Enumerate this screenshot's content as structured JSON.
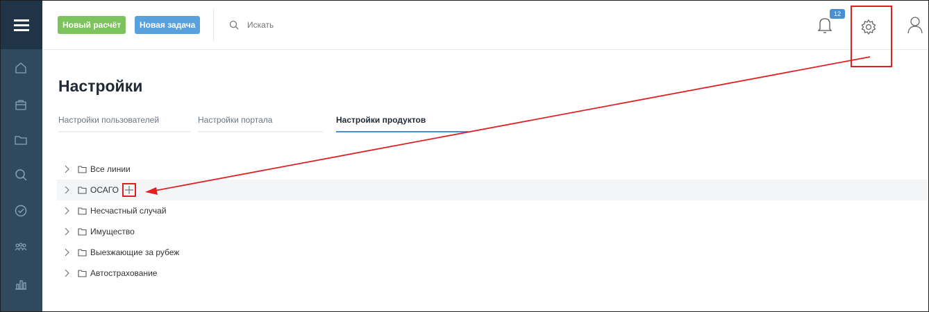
{
  "header": {
    "new_calc_label": "Новый расчёт",
    "new_task_label": "Новая задача",
    "search_placeholder": "Искать",
    "notifications_count": "12"
  },
  "page": {
    "title": "Настройки",
    "tabs": [
      {
        "label": "Настройки пользователей",
        "active": false
      },
      {
        "label": "Настройки портала",
        "active": false
      },
      {
        "label": "Настройки продуктов",
        "active": true
      }
    ]
  },
  "tree": {
    "items": [
      {
        "label": "Все линии"
      },
      {
        "label": "ОСАГО",
        "highlighted": true
      },
      {
        "label": "Несчастный случай"
      },
      {
        "label": "Имущество"
      },
      {
        "label": "Выезжающие за рубеж"
      },
      {
        "label": "Автострахование"
      }
    ]
  },
  "sidebar": {
    "icons": [
      "home-icon",
      "briefcase-icon",
      "folder-icon",
      "search-icon",
      "check-circle-icon",
      "people-icon",
      "bar-chart-icon"
    ]
  },
  "colors": {
    "sidebar": "#2f4a5f",
    "accent_green": "#7dc35d",
    "accent_blue": "#58a1dd",
    "annotation_red": "#e02020"
  }
}
